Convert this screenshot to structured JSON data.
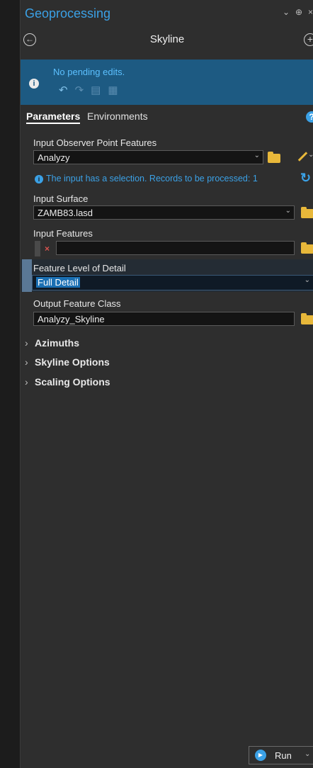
{
  "pane": {
    "title": "Geoprocessing",
    "tool_title": "Skyline"
  },
  "edits": {
    "message": "No pending edits."
  },
  "tabs": [
    {
      "label": "Parameters",
      "active": true
    },
    {
      "label": "Environments",
      "active": false
    }
  ],
  "params": {
    "observer": {
      "label": "Input Observer Point Features",
      "value": "Analyzy"
    },
    "selection_info": "The input has a selection. Records to be processed: 1",
    "surface": {
      "label": "Input Surface",
      "value": "ZAMB83.lasd"
    },
    "features": {
      "label": "Input Features",
      "value": ""
    },
    "lod": {
      "label": "Feature Level of Detail",
      "value": "Full Detail"
    },
    "output": {
      "label": "Output Feature Class",
      "value": "Analyzy_Skyline"
    }
  },
  "sections": [
    {
      "label": "Azimuths"
    },
    {
      "label": "Skyline Options"
    },
    {
      "label": "Scaling Options"
    }
  ],
  "run": {
    "label": "Run"
  },
  "colors": {
    "accent": "#3ba1e6",
    "banner": "#1d5a82",
    "folder": "#e8b83a",
    "error": "#d9534f"
  }
}
